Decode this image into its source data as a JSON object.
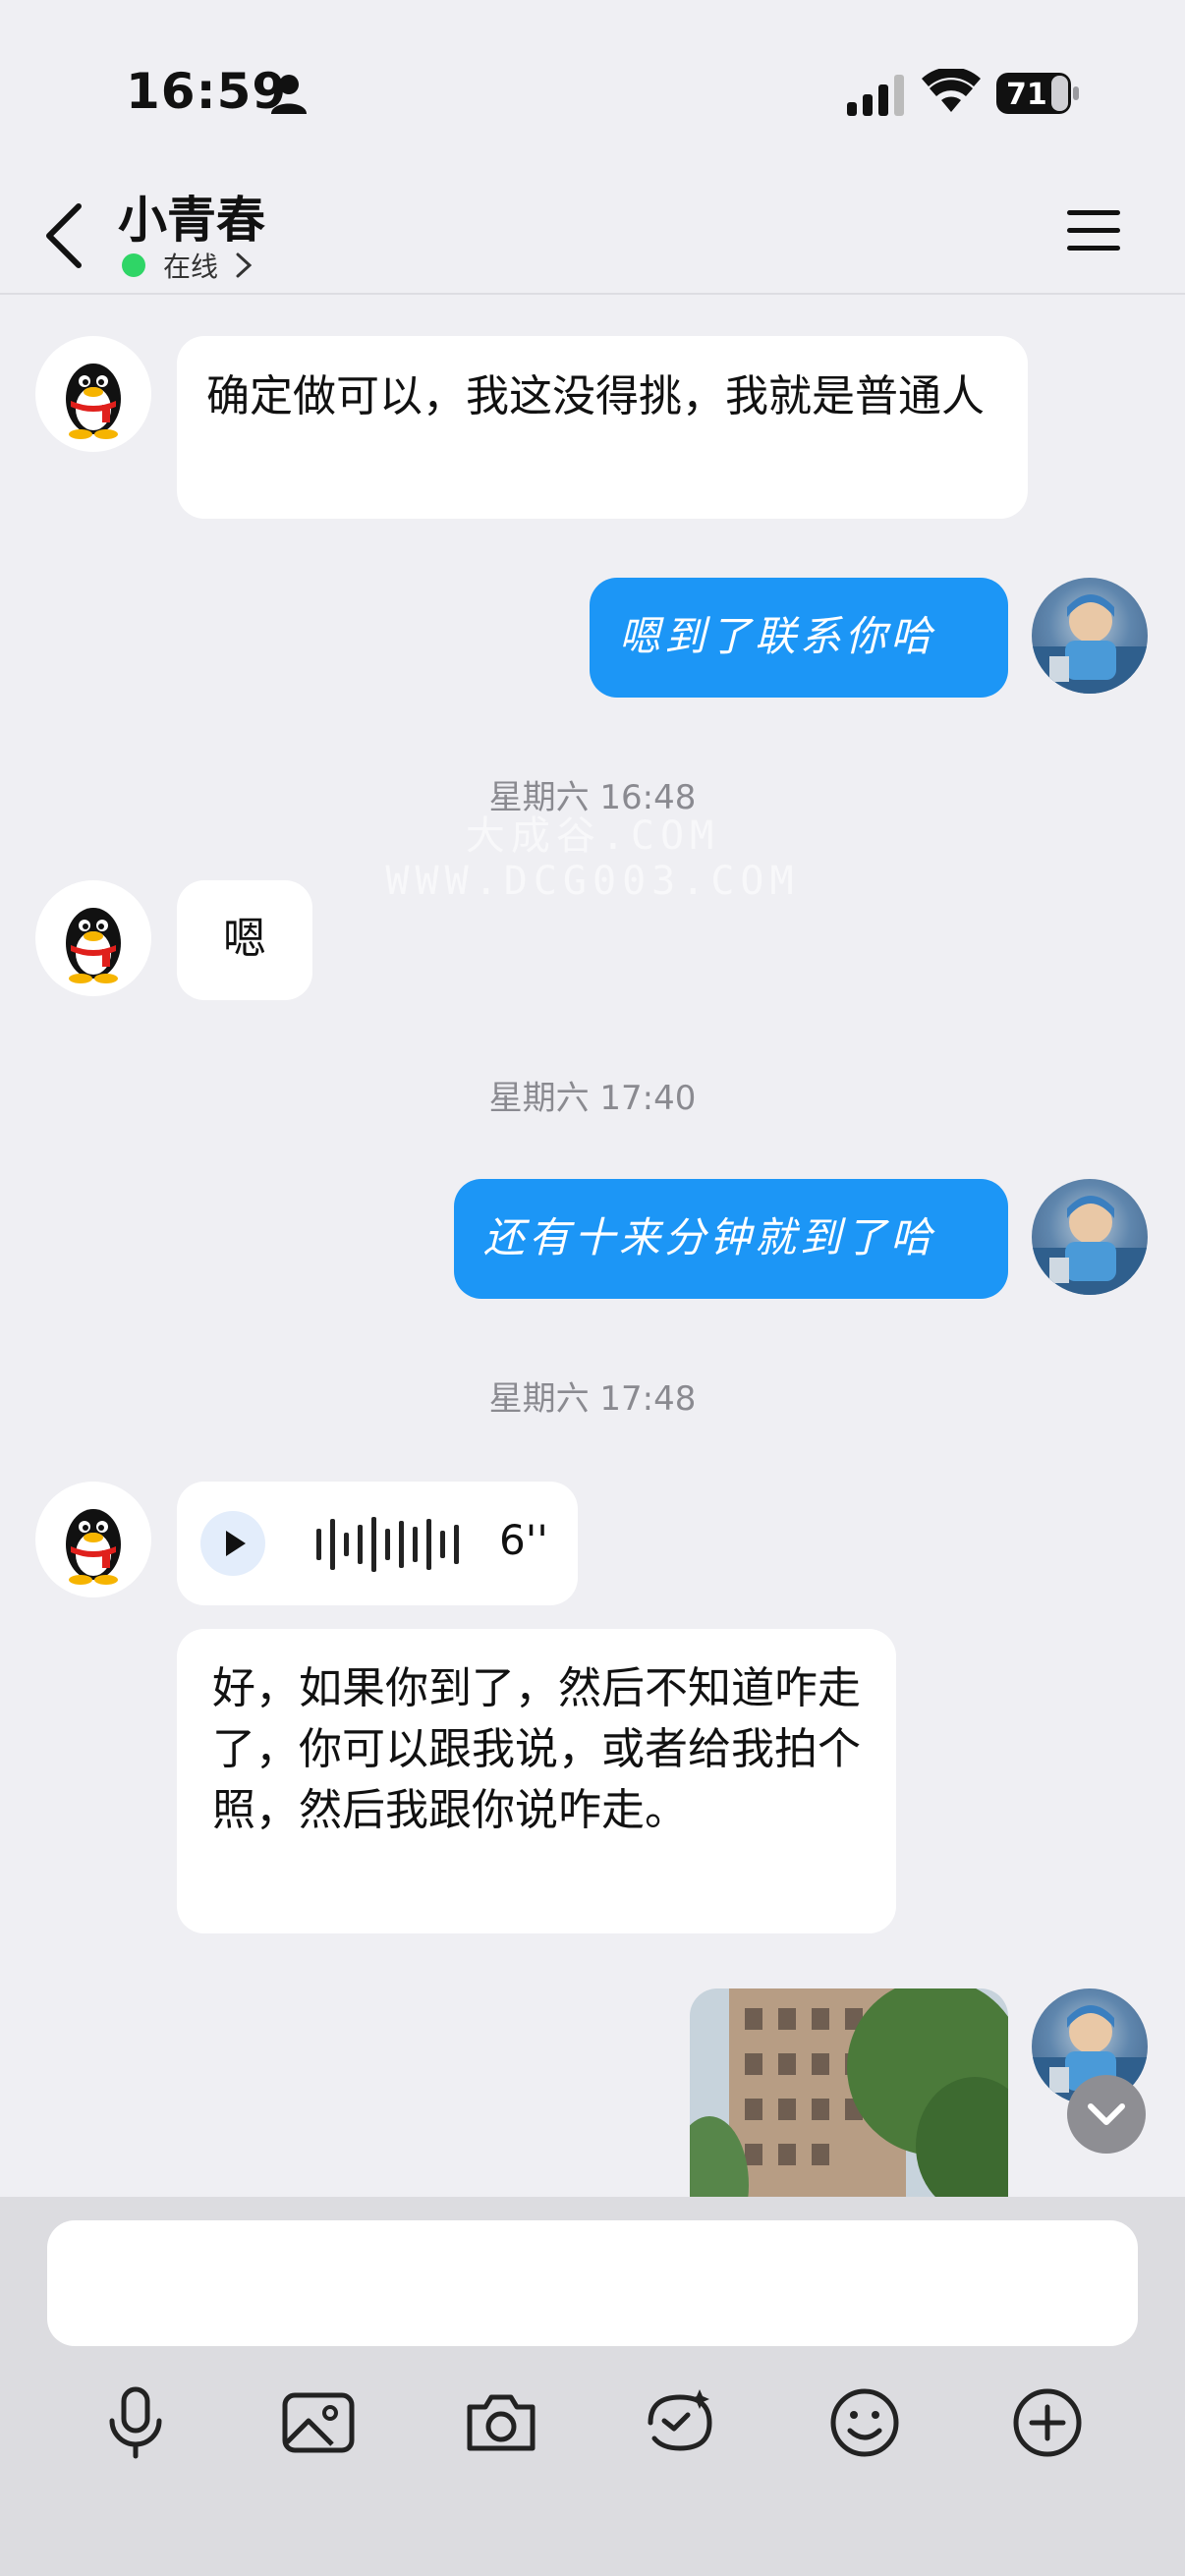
{
  "status_bar": {
    "time": "16:59",
    "battery": "71"
  },
  "header": {
    "contact_name": "小青春",
    "presence": "在线"
  },
  "messages": [
    {
      "from": "contact",
      "text": "确定做可以，我这没得挑，我就是普通人"
    },
    {
      "from": "me",
      "text": "嗯到了联系你哈"
    },
    {
      "type": "timestamp",
      "text": "星期六 16:48"
    },
    {
      "from": "contact",
      "text": "嗯"
    },
    {
      "type": "timestamp",
      "text": "星期六 17:40"
    },
    {
      "from": "me",
      "text": "还有十来分钟就到了哈"
    },
    {
      "type": "timestamp",
      "text": "星期六 17:48"
    },
    {
      "from": "contact",
      "type": "voice",
      "duration": "6''"
    },
    {
      "from": "contact",
      "text": "好，如果你到了，然后不知道咋走了，你可以跟我说，或者给我拍个照，然后我跟你说咋走。"
    },
    {
      "from": "me",
      "type": "photo"
    }
  ],
  "watermark": {
    "line1": "大成谷.COM",
    "line2": "WWW.DCG003.COM"
  },
  "input": {
    "placeholder": ""
  },
  "toolbar": {
    "icons": [
      "microphone-icon",
      "image-icon",
      "camera-icon",
      "red-packet-icon",
      "emoji-icon",
      "plus-icon"
    ]
  },
  "colors": {
    "background": "#efeff3",
    "outgoing_bubble": "#1c96f6",
    "incoming_bubble": "#ffffff",
    "online_dot": "#2fd566"
  }
}
